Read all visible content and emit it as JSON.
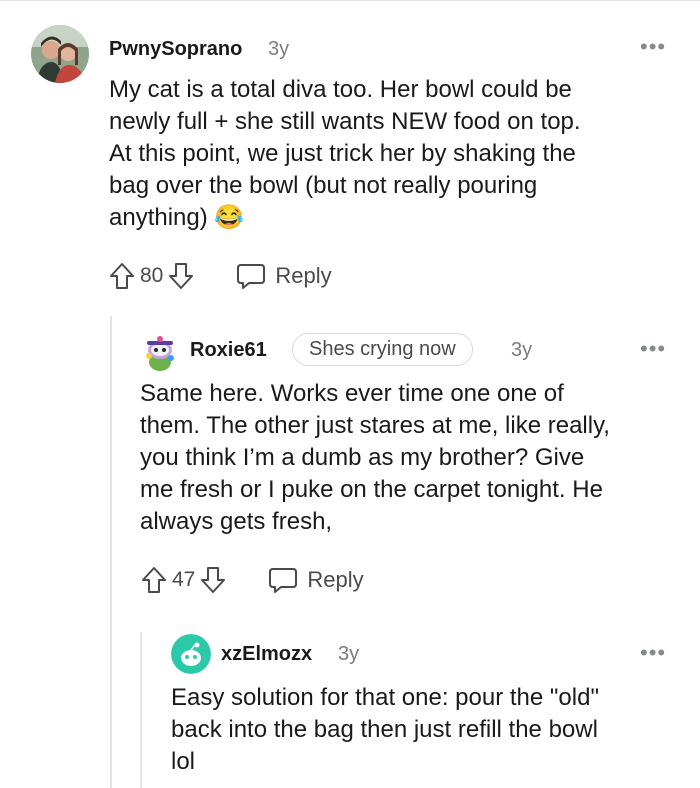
{
  "comments": [
    {
      "username": "PwnySoprano",
      "age": "3y",
      "body_lines": [
        "My cat is a total diva too. Her bowl could be",
        "newly full + she still wants NEW food on top.",
        "At this point, we just trick her by shaking the",
        "bag over the bowl (but not really pouring",
        "anything)"
      ],
      "emoji": "😂",
      "votes": "80",
      "reply_label": "Reply",
      "more_label": "•••",
      "avatar_icon": "user-photo-avatar"
    },
    {
      "username": "Roxie61",
      "flair": "Shes crying now",
      "age": "3y",
      "body_lines": [
        "Same here. Works ever time one one of",
        "them. The other just stares at me, like really,",
        "you think I’m a dumb as my brother? Give",
        "me fresh or I puke on the carpet tonight. He",
        "always gets fresh,"
      ],
      "votes": "47",
      "reply_label": "Reply",
      "more_label": "•••",
      "avatar_icon": "snoo-avatar"
    },
    {
      "username": "xzElmozx",
      "age": "3y",
      "body_lines": [
        "Easy solution for that one: pour the \"old\"",
        "back into the bag then just refill the bowl",
        "lol"
      ],
      "more_label": "•••",
      "avatar_icon": "default-snoo-avatar"
    }
  ],
  "colors": {
    "text": "#1a1a1b",
    "meta": "#7c7c7c",
    "icon": "#4a4a4a",
    "thread_line": "#e3e3e3",
    "snoo_teal": "#2bc9a9"
  }
}
